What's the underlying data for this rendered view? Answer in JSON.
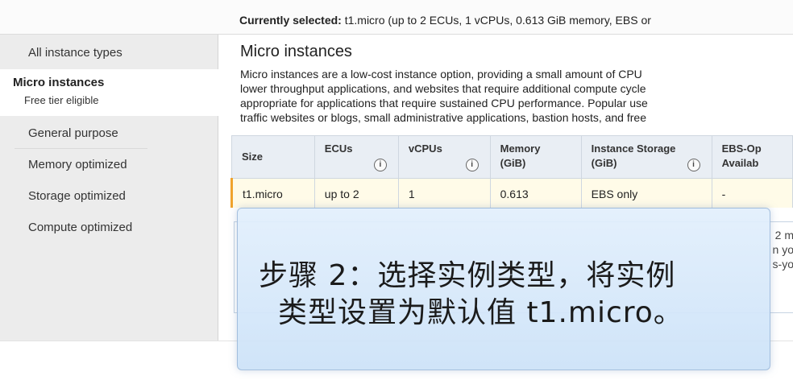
{
  "selection": {
    "label": "Currently selected:",
    "value": "t1.micro (up to 2 ECUs, 1 vCPUs, 0.613 GiB memory, EBS or"
  },
  "sidebar": {
    "items": [
      {
        "label": "All instance types"
      },
      {
        "label": "Micro instances",
        "sub": "Free tier eligible"
      },
      {
        "label": "General purpose"
      },
      {
        "label": "Memory optimized"
      },
      {
        "label": "Storage optimized"
      },
      {
        "label": "Compute optimized"
      }
    ]
  },
  "main": {
    "title": "Micro instances",
    "description_lines": [
      "Micro instances are a low-cost instance option, providing a small amount of CPU",
      "lower throughput applications, and websites that require additional compute cycle",
      "appropriate for applications that require sustained CPU performance. Popular use",
      "traffic websites or blogs, small administrative applications, bastion hosts, and free"
    ]
  },
  "table": {
    "headers": [
      {
        "line1": "Size",
        "line2": ""
      },
      {
        "line1": "ECUs",
        "line2": ""
      },
      {
        "line1": "vCPUs",
        "line2": ""
      },
      {
        "line1": "Memory",
        "line2": "(GiB)"
      },
      {
        "line1": "Instance Storage",
        "line2": "(GiB)"
      },
      {
        "line1": "EBS-Op",
        "line2": "Availab"
      }
    ],
    "info_glyph": "i",
    "rows": [
      [
        "t1.micro",
        "up to 2",
        "1",
        "0.613",
        "EBS only",
        "-"
      ]
    ]
  },
  "peek": {
    "line1": "2 m",
    "line2": "n yo",
    "line3": "s-yo"
  },
  "caption": {
    "line1": "步骤 2：选择实例类型，将实例",
    "line2": "类型设置为默认值 t1.micro。"
  },
  "colors": {
    "selected_accent": "#f0a32c",
    "header_bg": "#e9eef4",
    "sidebar_bg": "#ececec"
  }
}
